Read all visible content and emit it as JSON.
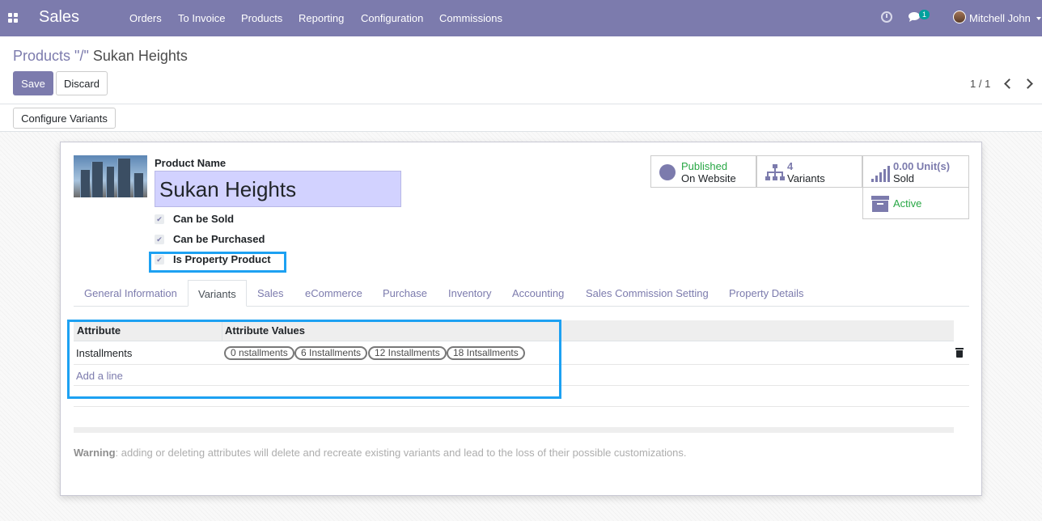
{
  "app": {
    "title": "Sales"
  },
  "menu": [
    "Orders",
    "To Invoice",
    "Products",
    "Reporting",
    "Configuration",
    "Commissions"
  ],
  "systray": {
    "chat_count": "1",
    "user": "Mitchell John"
  },
  "breadcrumb": {
    "parent": "Products",
    "separator": " \"/\" ",
    "current": "Sukan Heights"
  },
  "buttons": {
    "save": "Save",
    "discard": "Discard",
    "configure_variants": "Configure Variants"
  },
  "pager": {
    "value": "1 / 1"
  },
  "product": {
    "name_label": "Product Name",
    "name": "Sukan Heights",
    "checkboxes": [
      {
        "label": "Can be Sold",
        "checked": true
      },
      {
        "label": "Can be Purchased",
        "checked": true
      },
      {
        "label": "Is Property Product",
        "checked": true
      }
    ]
  },
  "smart_buttons": {
    "website": {
      "status": "Published",
      "label": "On Website"
    },
    "variants": {
      "count": "4",
      "label": "Variants"
    },
    "sold": {
      "value": "0.00 Unit(s)",
      "label": "Sold"
    },
    "active": {
      "label": "Active"
    }
  },
  "tabs": [
    "General Information",
    "Variants",
    "Sales",
    "eCommerce",
    "Purchase",
    "Inventory",
    "Accounting",
    "Sales Commission Setting",
    "Property Details"
  ],
  "active_tab": "Variants",
  "attributes_table": {
    "columns": [
      "Attribute",
      "Attribute Values"
    ],
    "rows": [
      {
        "attribute": "Installments",
        "values": [
          "0 nstallments",
          "6 Installments",
          "12 Installments",
          "18 Intsallments"
        ]
      }
    ],
    "add_line": "Add a line"
  },
  "warning": {
    "bold": "Warning",
    "text": ": adding or deleting attributes will delete and recreate existing variants and lead to the loss of their possible customizations."
  },
  "colors": {
    "brand": "#7c7bad",
    "highlight": "#1da1f2",
    "published": "#28a745",
    "active": "#28a745"
  }
}
